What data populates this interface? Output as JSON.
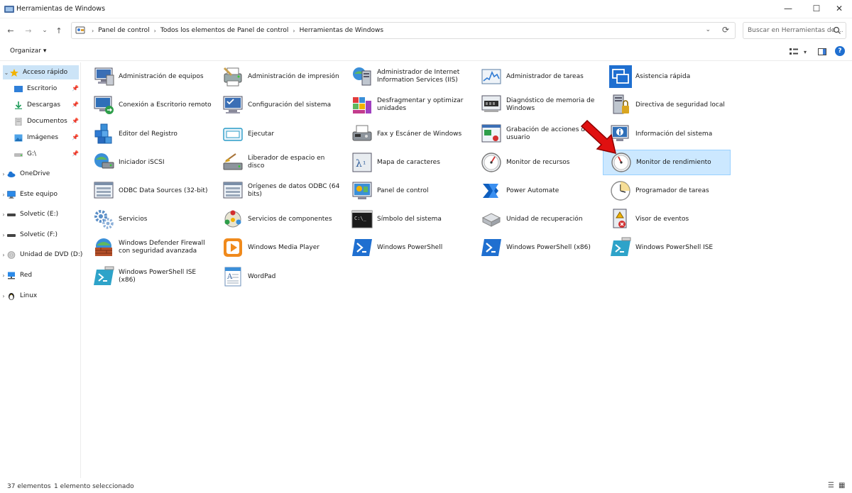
{
  "window": {
    "title": "Herramientas de Windows",
    "minimize_glyph": "—",
    "maximize_glyph": "☐",
    "close_glyph": "✕"
  },
  "nav": {
    "back_glyph": "←",
    "forward_glyph": "→",
    "recent_glyph": "⌄",
    "up_glyph": "↑",
    "breadcrumbs": [
      "Panel de control",
      "Todos los elementos de Panel de control",
      "Herramientas de Windows"
    ],
    "search_placeholder": "Buscar en Herramientas de ..."
  },
  "toolbar": {
    "organize_label": "Organizar",
    "organize_caret": "▾"
  },
  "sidebar": {
    "items": [
      {
        "label": "Acceso rápido",
        "icon": "star-icon",
        "pinned": false
      },
      {
        "label": "Escritorio",
        "icon": "desktop-icon",
        "pinned": true
      },
      {
        "label": "Descargas",
        "icon": "download-icon",
        "pinned": true
      },
      {
        "label": "Documentos",
        "icon": "documents-icon",
        "pinned": true
      },
      {
        "label": "Imágenes",
        "icon": "pictures-icon",
        "pinned": true
      },
      {
        "label": "G:\\",
        "icon": "drive-icon",
        "pinned": true
      },
      {
        "label": "OneDrive",
        "icon": "cloud-icon",
        "pinned": false
      },
      {
        "label": "Este equipo",
        "icon": "computer-icon",
        "pinned": false
      },
      {
        "label": "Solvetic (E:)",
        "icon": "drive-icon",
        "pinned": false
      },
      {
        "label": "Solvetic (F:)",
        "icon": "drive-icon",
        "pinned": false
      },
      {
        "label": "Unidad de DVD (D:)",
        "icon": "dvd-icon",
        "pinned": false
      },
      {
        "label": "Red",
        "icon": "network-icon",
        "pinned": false
      },
      {
        "label": "Linux",
        "icon": "penguin-icon",
        "pinned": false
      }
    ]
  },
  "tools": [
    {
      "label": "Administración de equipos",
      "icon": "computer-management-icon"
    },
    {
      "label": "Administración de impresión",
      "icon": "print-management-icon"
    },
    {
      "label": "Administrador de Internet Information Services (IIS)",
      "icon": "iis-icon"
    },
    {
      "label": "Administrador de tareas",
      "icon": "task-manager-icon"
    },
    {
      "label": "Asistencia rápida",
      "icon": "quick-assist-icon"
    },
    {
      "label": "Conexión a Escritorio remoto",
      "icon": "remote-desktop-icon"
    },
    {
      "label": "Configuración del sistema",
      "icon": "system-config-icon"
    },
    {
      "label": "Desfragmentar y optimizar unidades",
      "icon": "defrag-icon"
    },
    {
      "label": "Diagnóstico de memoria de Windows",
      "icon": "memory-diagnostic-icon"
    },
    {
      "label": "Directiva de seguridad local",
      "icon": "security-policy-icon"
    },
    {
      "label": "Editor del Registro",
      "icon": "registry-editor-icon"
    },
    {
      "label": "Ejecutar",
      "icon": "run-icon"
    },
    {
      "label": "Fax y Escáner de Windows",
      "icon": "fax-scanner-icon"
    },
    {
      "label": "Grabación de acciones de usuario",
      "icon": "steps-recorder-icon"
    },
    {
      "label": "Información del sistema",
      "icon": "system-info-icon"
    },
    {
      "label": "Iniciador iSCSI",
      "icon": "iscsi-icon"
    },
    {
      "label": "Liberador de espacio en disco",
      "icon": "disk-cleanup-icon"
    },
    {
      "label": "Mapa de caracteres",
      "icon": "character-map-icon"
    },
    {
      "label": "Monitor de recursos",
      "icon": "resource-monitor-icon"
    },
    {
      "label": "Monitor de rendimiento",
      "icon": "performance-monitor-icon"
    },
    {
      "label": "ODBC Data Sources (32-bit)",
      "icon": "odbc-icon"
    },
    {
      "label": "Orígenes de datos ODBC (64 bits)",
      "icon": "odbc-icon"
    },
    {
      "label": "Panel de control",
      "icon": "control-panel-icon"
    },
    {
      "label": "Power Automate",
      "icon": "power-automate-icon"
    },
    {
      "label": "Programador de tareas",
      "icon": "task-scheduler-icon"
    },
    {
      "label": "Servicios",
      "icon": "services-icon"
    },
    {
      "label": "Servicios de componentes",
      "icon": "component-services-icon"
    },
    {
      "label": "Símbolo del sistema",
      "icon": "command-prompt-icon"
    },
    {
      "label": "Unidad de recuperación",
      "icon": "recovery-drive-icon"
    },
    {
      "label": "Visor de eventos",
      "icon": "event-viewer-icon"
    },
    {
      "label": "Windows Defender Firewall con seguridad avanzada",
      "icon": "firewall-icon"
    },
    {
      "label": "Windows Media Player",
      "icon": "media-player-icon"
    },
    {
      "label": "Windows PowerShell",
      "icon": "powershell-icon"
    },
    {
      "label": "Windows PowerShell (x86)",
      "icon": "powershell-icon"
    },
    {
      "label": "Windows PowerShell ISE",
      "icon": "powershell-ise-icon"
    },
    {
      "label": "Windows PowerShell ISE (x86)",
      "icon": "powershell-ise-icon"
    },
    {
      "label": "WordPad",
      "icon": "wordpad-icon"
    }
  ],
  "selected_tool": "Monitor de rendimiento",
  "status": {
    "count": "37 elementos",
    "selection": "1 elemento seleccionado"
  },
  "colors": {
    "selection": "#cce8ff",
    "annotation_arrow": "#e01010"
  }
}
